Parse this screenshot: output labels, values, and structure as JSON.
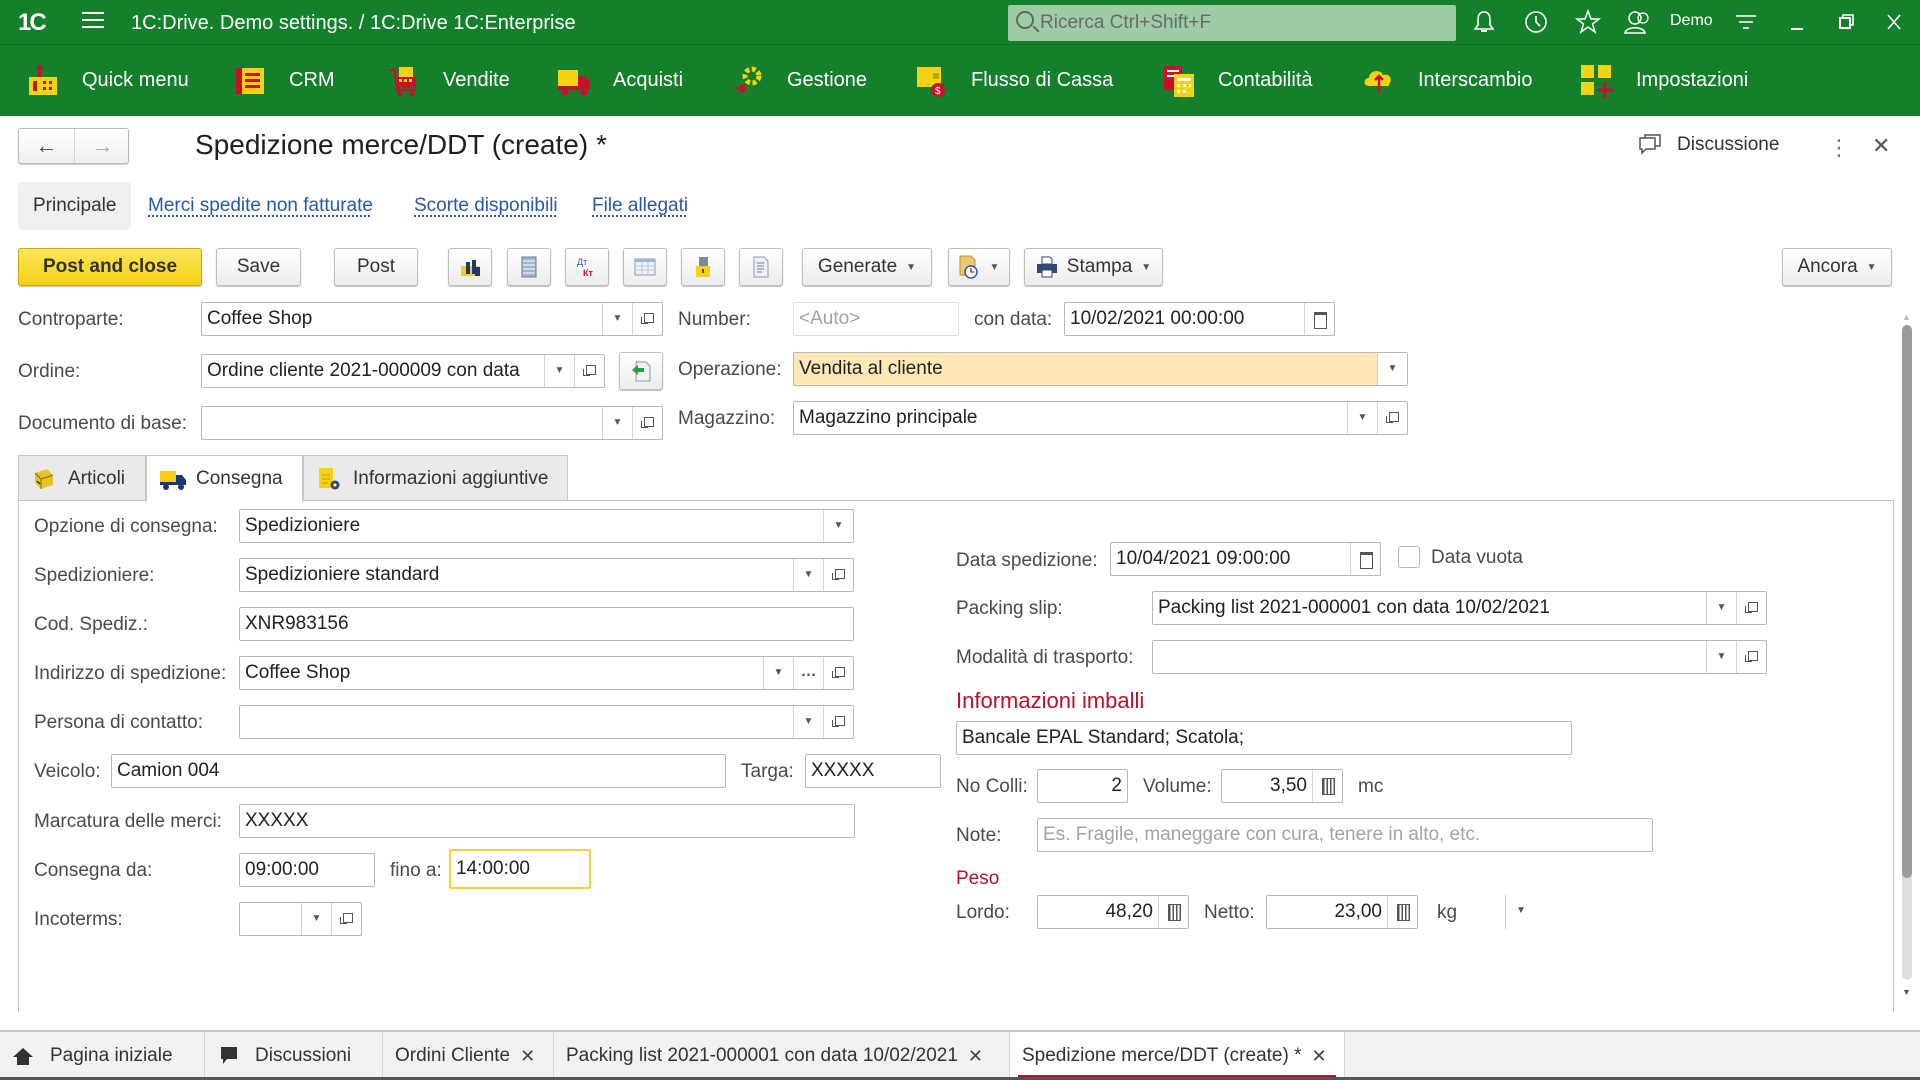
{
  "window": {
    "title": "1C:Drive. Demo settings. / 1C:Drive 1C:Enterprise",
    "logo": "1C",
    "search_placeholder": "Ricerca Ctrl+Shift+F",
    "user": "Demo",
    "icons": [
      "bell-icon",
      "history-icon",
      "star-icon",
      "user-icon",
      "settings-icon",
      "minimize-icon",
      "restore-icon",
      "close-icon"
    ]
  },
  "sections": [
    {
      "label": "Quick menu",
      "icon": "quick-menu-icon"
    },
    {
      "label": "CRM",
      "icon": "crm-icon"
    },
    {
      "label": "Vendite",
      "icon": "cart-icon"
    },
    {
      "label": "Acquisti",
      "icon": "truck-icon"
    },
    {
      "label": "Gestione",
      "icon": "gear-icon"
    },
    {
      "label": "Flusso di Cassa",
      "icon": "wallet-icon"
    },
    {
      "label": "Contabilità",
      "icon": "ledger-icon"
    },
    {
      "label": "Interscambio",
      "icon": "cloud-exchange-icon"
    },
    {
      "label": "Impostazioni",
      "icon": "settings-grid-icon"
    }
  ],
  "form": {
    "title": "Spedizione merce/DDT (create) *",
    "discussion_label": "Discussione",
    "tabs": [
      {
        "label": "Principale",
        "active": true
      },
      {
        "label": "Merci spedite non fatturate",
        "active": false
      },
      {
        "label": "Scorte disponibili",
        "active": false
      },
      {
        "label": "File allegati",
        "active": false
      }
    ],
    "toolbar": {
      "post_and_close": "Post and close",
      "save": "Save",
      "post": "Post",
      "generate": "Generate",
      "print": "Stampa",
      "more": "Ancora"
    },
    "header": {
      "counterparty_label": "Controparte:",
      "counterparty": "Coffee Shop",
      "order_label": "Ordine:",
      "order": "Ordine cliente 2021-000009 con data",
      "base_doc_label": "Documento di base:",
      "base_doc": "",
      "number_label": "Number:",
      "number_placeholder": "<Auto>",
      "date_label": "con data:",
      "date": "10/02/2021 00:00:00",
      "operation_label": "Operazione:",
      "operation": "Vendita al cliente",
      "warehouse_label": "Magazzino:",
      "warehouse": "Magazzino principale"
    },
    "page_tabs": [
      {
        "label": "Articoli",
        "icon": "box-icon",
        "active": false
      },
      {
        "label": "Consegna",
        "icon": "delivery-truck-icon",
        "active": true
      },
      {
        "label": "Informazioni aggiuntive",
        "icon": "document-settings-icon",
        "active": false
      }
    ],
    "delivery": {
      "option_label": "Opzione di consegna:",
      "option": "Spedizioniere",
      "carrier_label": "Spedizioniere:",
      "carrier": "Spedizioniere standard",
      "tracking_label": "Cod. Spediz.:",
      "tracking": "XNR983156",
      "address_label": "Indirizzo di spedizione:",
      "address": "Coffee Shop",
      "contact_label": "Persona di contatto:",
      "contact": "",
      "vehicle_label": "Veicolo:",
      "vehicle": "Camion 004",
      "plate_label": "Targa:",
      "plate": "XXXXX",
      "marking_label": "Marcatura delle merci:",
      "marking": "XXXXX",
      "from_label": "Consegna da:",
      "from": "09:00:00",
      "to_label": "fino a:",
      "to": "14:00:00",
      "incoterms_label": "Incoterms:",
      "incoterms": "",
      "ship_date_label": "Data spedizione:",
      "ship_date": "10/04/2021 09:00:00",
      "empty_date_label": "Data vuota",
      "empty_date_checked": false,
      "packing_slip_label": "Packing slip:",
      "packing_slip": "Packing list 2021-000001 con data 10/02/2021",
      "transport_label": "Modalità di trasporto:",
      "transport": "",
      "packaging_title": "Informazioni imballi",
      "packaging": "Bancale EPAL Standard; Scatola;",
      "packages_label": "No Colli:",
      "packages": "2",
      "volume_label": "Volume:",
      "volume": "3,50",
      "volume_unit": "mc",
      "notes_label": "Note:",
      "notes_placeholder": "Es. Fragile, maneggare con cura, tenere in alto, etc.",
      "notes": "",
      "weight_title": "Peso",
      "gross_label": "Lordo:",
      "gross": "48,20",
      "net_label": "Netto:",
      "net": "23,00",
      "weight_unit": "kg"
    }
  },
  "taskbar": [
    {
      "label": "Pagina iniziale",
      "icon": "home-icon",
      "closable": false,
      "active": false
    },
    {
      "label": "Discussioni",
      "icon": "chat-icon",
      "closable": false,
      "active": false
    },
    {
      "label": "Ordini Cliente",
      "closable": true,
      "active": false
    },
    {
      "label": "Packing list 2021-000001 con data 10/02/2021",
      "closable": true,
      "active": false
    },
    {
      "label": "Spedizione merce/DDT (create) *",
      "closable": true,
      "active": true
    }
  ],
  "colors": {
    "brand_green": "#14802b",
    "primary_button": "#f5d215",
    "link": "#2958a8",
    "section_title": "#b5132b",
    "highlight_field": "#fde8b6"
  }
}
